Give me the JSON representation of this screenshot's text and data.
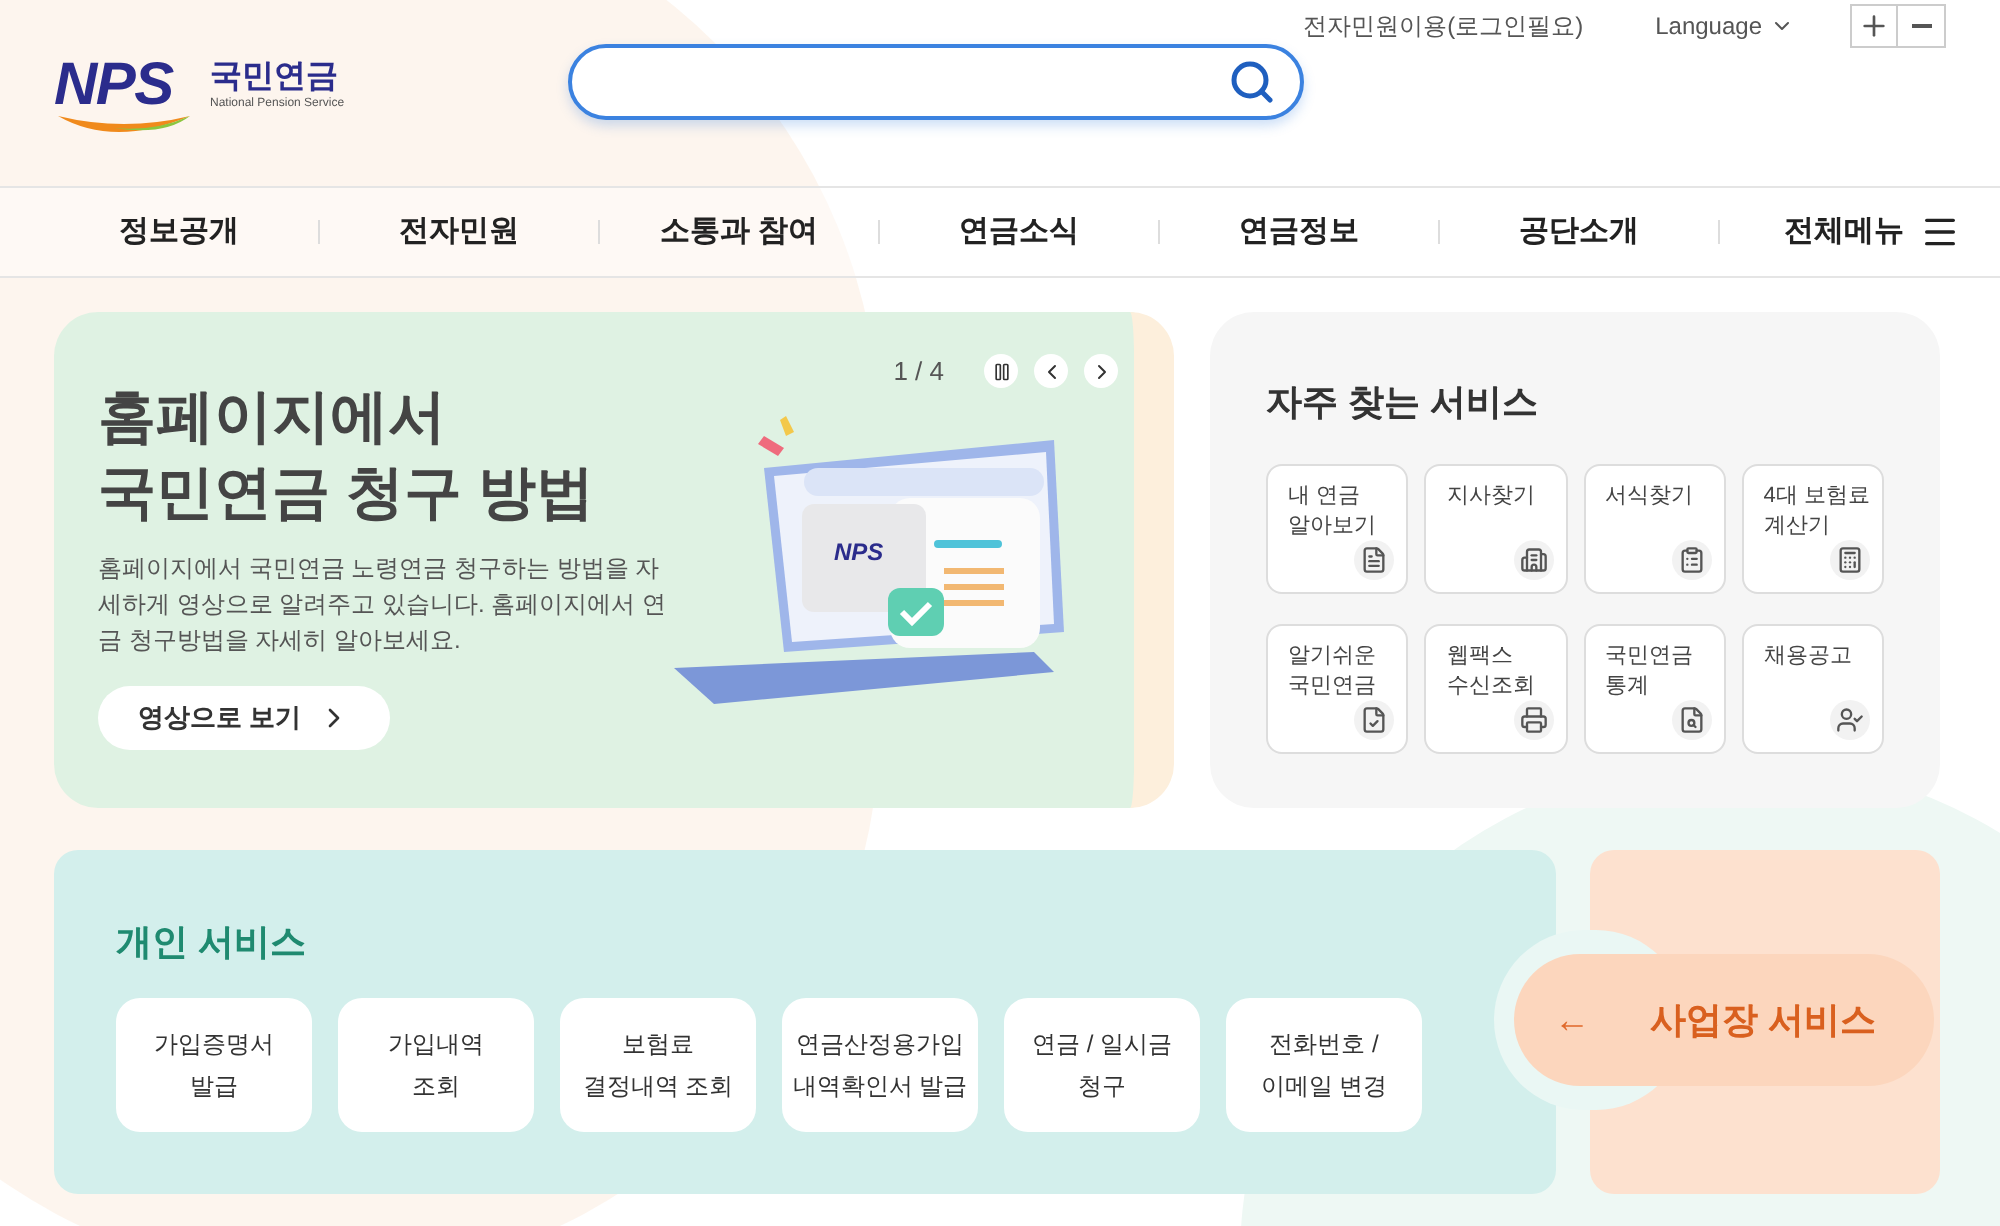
{
  "logo": {
    "mark": "NPS",
    "name": "국민연금",
    "subtitle": "National Pension Service"
  },
  "utility": {
    "link": "전자민원이용(로그인필요)",
    "language": "Language"
  },
  "nav": {
    "items": [
      "정보공개",
      "전자민원",
      "소통과 참여",
      "연금소식",
      "연금정보",
      "공단소개"
    ],
    "all_menu": "전체메뉴"
  },
  "hero": {
    "counter": "1 / 4",
    "title_lines": [
      "홈페이지에서",
      "국민연금 청구 방법"
    ],
    "description": "홈페이지에서 국민연금 노령연금 청구하는 방법을 자세하게 영상으로 알려주고 있습니다. 홈페이지에서 연금 청구방법을 자세히 알아보세요.",
    "button": "영상으로 보기",
    "illustration_logo": "NPS"
  },
  "frequent_services": {
    "title": "자주 찾는 서비스",
    "items": [
      {
        "lines": [
          "내 연금",
          "알아보기"
        ]
      },
      {
        "lines": [
          "지사찾기"
        ]
      },
      {
        "lines": [
          "서식찾기"
        ]
      },
      {
        "lines": [
          "4대 보험료",
          "계산기"
        ]
      },
      {
        "lines": [
          "알기쉬운",
          "국민연금"
        ]
      },
      {
        "lines": [
          "웹팩스",
          "수신조회"
        ]
      },
      {
        "lines": [
          "국민연금",
          "통계"
        ]
      },
      {
        "lines": [
          "채용공고"
        ]
      }
    ]
  },
  "personal_services": {
    "title": "개인 서비스",
    "items": [
      {
        "lines": [
          "가입증명서",
          "발급"
        ]
      },
      {
        "lines": [
          "가입내역",
          "조회"
        ]
      },
      {
        "lines": [
          "보험료",
          "결정내역 조회"
        ]
      },
      {
        "lines": [
          "연금산정용가입",
          "내역확인서 발급"
        ]
      },
      {
        "lines": [
          "연금 / 일시금",
          "청구"
        ]
      },
      {
        "lines": [
          "전화번호 /",
          "이메일 변경"
        ]
      }
    ]
  },
  "business_services": {
    "arrow": "←",
    "label": "사업장 서비스"
  }
}
